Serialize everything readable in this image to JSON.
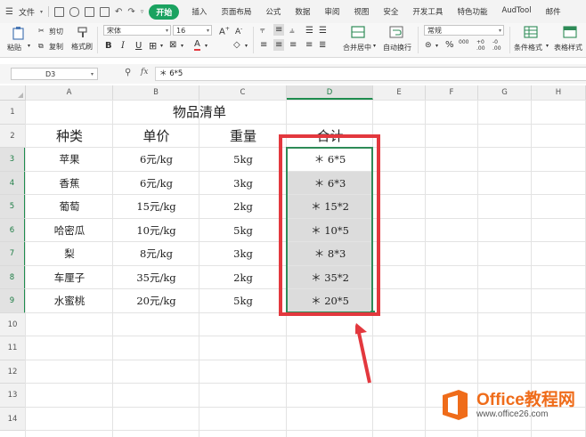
{
  "menu": {
    "file": "文件",
    "start": "开始",
    "tabs": [
      "插入",
      "页面布局",
      "公式",
      "数据",
      "审阅",
      "视图",
      "安全",
      "开发工具",
      "特色功能",
      "AudTool",
      "邮件"
    ]
  },
  "ribbon": {
    "paste": "粘贴",
    "cut": "剪切",
    "copy": "复制",
    "format_painter": "格式刷",
    "font_name": "宋体",
    "font_size": "16",
    "bold": "B",
    "italic": "I",
    "underline": "U",
    "merge_center": "合并居中",
    "wrap_text": "自动换行",
    "number_format": "常规",
    "percent": "%",
    "thousand": "000",
    "conditional_format": "条件格式",
    "table_style": "表格样式"
  },
  "formula_bar": {
    "name_box": "D3",
    "fx": "fx",
    "content": "＊ 6*5"
  },
  "columns": [
    "A",
    "B",
    "C",
    "D",
    "E",
    "F",
    "G",
    "H"
  ],
  "rows": [
    "1",
    "2",
    "3",
    "4",
    "5",
    "6",
    "7",
    "8",
    "9",
    "10",
    "11",
    "12",
    "13",
    "14"
  ],
  "sheet": {
    "title": "物品清单",
    "headers": [
      "种类",
      "单价",
      "重量",
      "合计"
    ],
    "data": [
      [
        "苹果",
        "6元/kg",
        "5kg",
        "＊ 6*5"
      ],
      [
        "香蕉",
        "6元/kg",
        "3kg",
        "＊ 6*3"
      ],
      [
        "葡萄",
        "15元/kg",
        "2kg",
        "＊ 15*2"
      ],
      [
        "哈密瓜",
        "10元/kg",
        "5kg",
        "＊ 10*5"
      ],
      [
        "梨",
        "8元/kg",
        "3kg",
        "＊ 8*3"
      ],
      [
        "车厘子",
        "35元/kg",
        "2kg",
        "＊ 35*2"
      ],
      [
        "水蜜桃",
        "20元/kg",
        "5kg",
        "＊ 20*5"
      ]
    ]
  },
  "watermark": {
    "brand": "Office教程网",
    "url": "www.office26.com"
  },
  "colors": {
    "accent_green": "#1aa260",
    "selection_green": "#2e8b57",
    "highlight_red": "#e3383e",
    "brand_orange": "#ef6c1a"
  }
}
